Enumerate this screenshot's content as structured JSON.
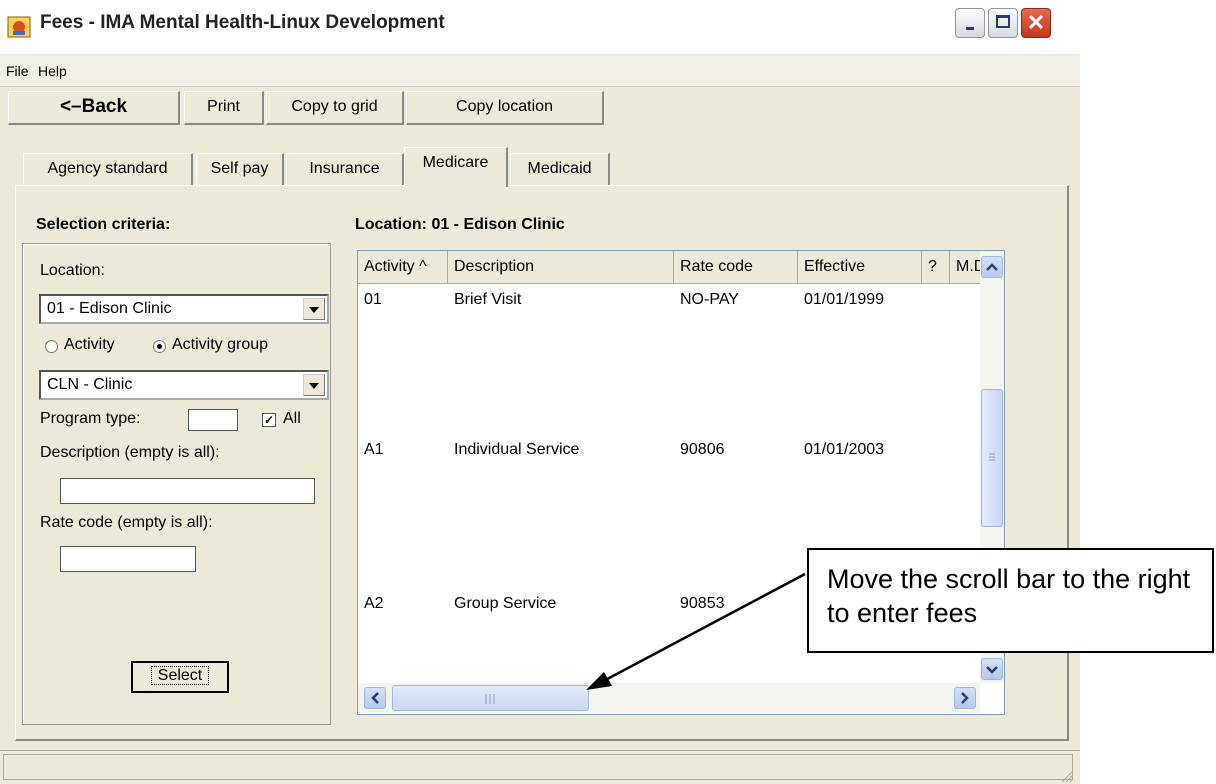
{
  "window": {
    "title": "Fees - IMA Mental Health-Linux Development",
    "close_glyph": "✕"
  },
  "menu": [
    "File",
    "Help"
  ],
  "toolbar": {
    "back_label": "<–Back",
    "print_label": "Print",
    "copy_grid_label": "Copy to grid",
    "copy_location_label": "Copy location"
  },
  "tabs": [
    "Agency standard",
    "Self pay",
    "Insurance",
    "Medicare",
    "Medicaid"
  ],
  "active_tab": "Medicare",
  "selection": {
    "title": "Selection criteria:",
    "location_label": "Location:",
    "location_value": "01 - Edison Clinic",
    "radio_activity": "Activity",
    "radio_activity_group": "Activity group",
    "radio_selected": "Activity group",
    "group_value": "CLN - Clinic",
    "program_type_label": "Program type:",
    "all_label": "All",
    "all_checked": true,
    "check_glyph": "✓",
    "description_label": "Description (empty is all):",
    "description_value": "",
    "rate_code_label": "Rate code (empty is all):",
    "rate_code_value": "",
    "select_label": "Select"
  },
  "grid": {
    "location_title": "Location: 01 - Edison Clinic",
    "columns": [
      "Activity ^",
      "Description",
      "Rate code",
      "Effective",
      "?",
      "M.D."
    ],
    "rows": [
      {
        "activity": "01",
        "description": "Brief Visit",
        "rate_code": "NO-PAY",
        "effective": "01/01/1999"
      },
      {
        "activity": "A1",
        "description": "Individual Service",
        "rate_code": "90806",
        "effective": "01/01/2003"
      },
      {
        "activity": "A2",
        "description": "Group Service",
        "rate_code": "90853",
        "effective": ""
      }
    ]
  },
  "callout": {
    "text": "Move the scroll bar to the right to enter fees"
  }
}
